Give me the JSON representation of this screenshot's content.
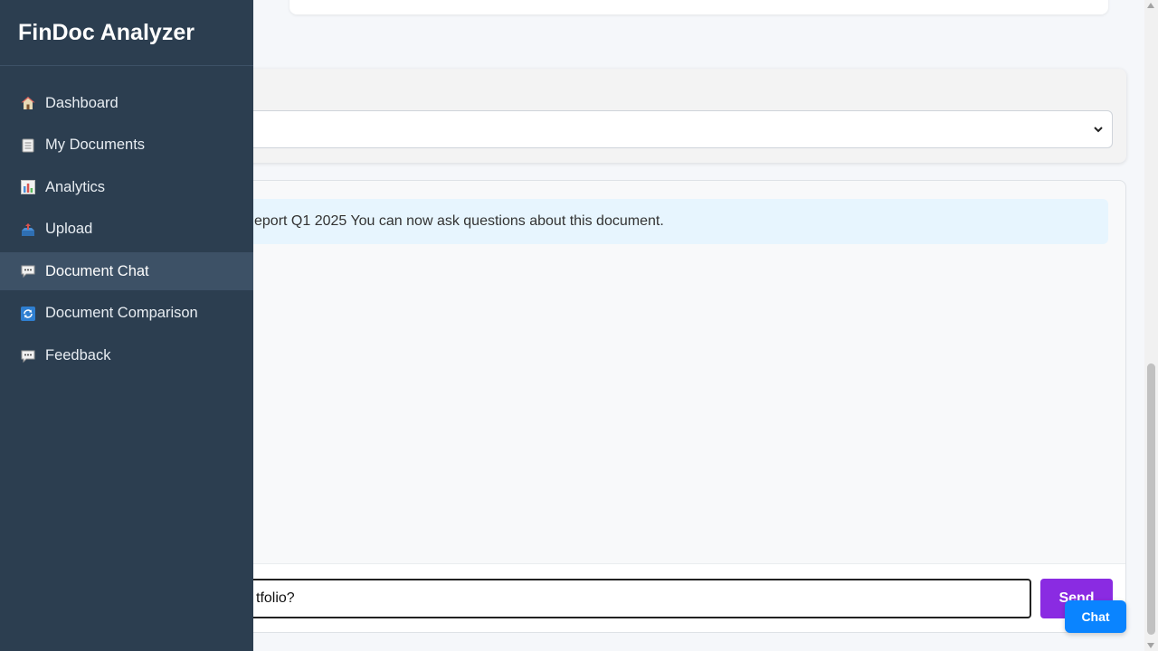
{
  "app": {
    "title": "FinDoc Analyzer"
  },
  "sidebar": {
    "items": [
      {
        "label": "Dashboard",
        "icon": "house-icon"
      },
      {
        "label": "My Documents",
        "icon": "document-icon"
      },
      {
        "label": "Analytics",
        "icon": "bar-chart-icon"
      },
      {
        "label": "Upload",
        "icon": "inbox-tray-icon"
      },
      {
        "label": "Document Chat",
        "icon": "speech-bubble-icon",
        "active": true
      },
      {
        "label": "Document Comparison",
        "icon": "refresh-arrows-icon"
      },
      {
        "label": "Feedback",
        "icon": "speech-bubble-icon"
      }
    ]
  },
  "chat": {
    "system_message": "eport Q1 2025 You can now ask questions about this document.",
    "input_value": "tfolio?",
    "send_label": "Send"
  },
  "chat_fab": {
    "label": "Chat"
  },
  "colors": {
    "sidebar_bg": "#2c3e50",
    "active_item_bg": "#3d5166",
    "send_button": "#8a2be2",
    "chat_fab": "#0a84ff",
    "system_message_bg": "#e7f5fe"
  }
}
